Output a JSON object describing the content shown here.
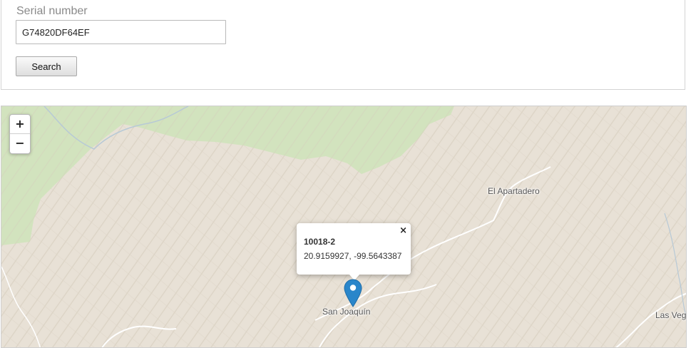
{
  "search": {
    "label": "Serial number",
    "value": "G74820DF64EF",
    "button_label": "Search"
  },
  "map": {
    "zoom_in_label": "+",
    "zoom_out_label": "−",
    "places": {
      "el_apartadero": "El Apartadero",
      "san_joaquin": "San Joaquín",
      "las_vegas": "Las Vega"
    },
    "popup": {
      "title": "10018-2",
      "coordinates": "20.9159927, -99.5643387",
      "close": "×"
    },
    "marker": {
      "icon": "map-pin-icon",
      "color": "#2a86ca"
    },
    "colors": {
      "terrain": "#e8e1d6",
      "forest": "#cfe3bb",
      "roads": "#ffffff"
    }
  }
}
